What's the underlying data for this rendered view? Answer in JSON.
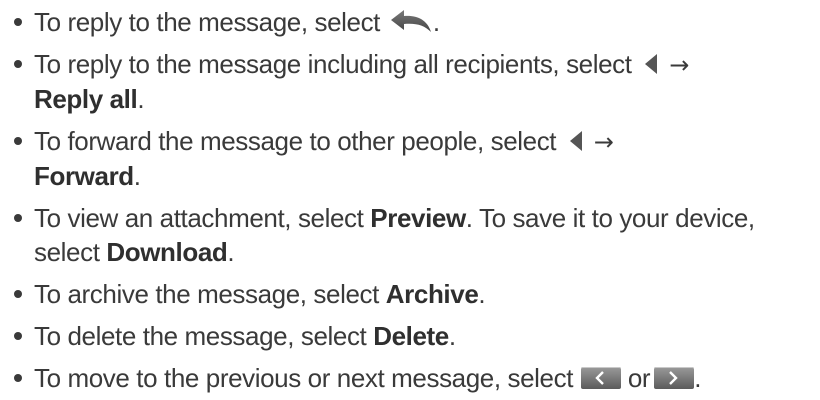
{
  "bullets": [
    {
      "text": "To reply to the message, select",
      "end": "."
    },
    {
      "text": "To reply to the message including all recipients, select",
      "arrow": "→",
      "action": "Reply all",
      "end": "."
    },
    {
      "text": "To forward the message to other people, select",
      "arrow": "→",
      "action": "Forward",
      "end": "."
    },
    {
      "text_a": "To view an attachment, select",
      "action_a": "Preview",
      "text_b": ". To save it to your device, select",
      "action_b": "Download",
      "end": "."
    },
    {
      "text": "To archive the message, select",
      "action": "Archive",
      "end": "."
    },
    {
      "text": "To delete the message, select",
      "action": "Delete",
      "end": "."
    },
    {
      "text": "To move to the previous or next message, select",
      "conj": "or",
      "end": "."
    }
  ],
  "icons": {
    "reply": "reply-arrow-icon",
    "more": "more-options-triangle-icon",
    "previous": "previous-message-button",
    "next": "next-message-button"
  },
  "colors": {
    "text": "#3a3a3a",
    "icon": "#555555",
    "button_top": "#9a9a9a",
    "button_bottom": "#5b5b5b"
  }
}
